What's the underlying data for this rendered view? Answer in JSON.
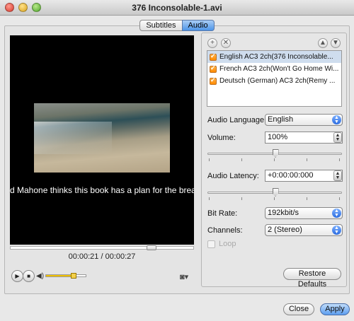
{
  "window": {
    "title": "376 Inconsolable-1.avi"
  },
  "tabs": [
    {
      "label": "Subtitles",
      "active": false
    },
    {
      "label": "Audio",
      "active": true
    }
  ],
  "player": {
    "subtitle_text": "d Mahone thinks this book has a plan for the break",
    "timecode": "00:00:21 / 00:00:27",
    "progress_fraction": 0.78,
    "volume_fraction": 0.7
  },
  "audio_tracks": [
    {
      "label": "English AC3 2ch(376 Inconsolable...",
      "checked": true,
      "selected": true
    },
    {
      "label": "French AC3 2ch(Won't Go Home Wi...",
      "checked": true,
      "selected": false
    },
    {
      "label": "Deutsch (German) AC3 2ch(Remy ...",
      "checked": true,
      "selected": false
    }
  ],
  "settings": {
    "audio_language_label": "Audio Language:",
    "audio_language_value": "English",
    "volume_label": "Volume:",
    "volume_value": "100%",
    "audio_latency_label": "Audio Latency:",
    "audio_latency_value": "+0:00:00:000",
    "bit_rate_label": "Bit Rate:",
    "bit_rate_value": "192kbit/s",
    "channels_label": "Channels:",
    "channels_value": "2 (Stereo)",
    "loop_label": "Loop",
    "volume_slider_fraction": 0.5,
    "latency_slider_fraction": 0.5
  },
  "buttons": {
    "restore_defaults": "Restore Defaults",
    "close": "Close",
    "apply": "Apply"
  },
  "colors": {
    "accent": "#4d95e8",
    "checkbox": "#ff8a00",
    "volume_fill": "#f2c100"
  }
}
